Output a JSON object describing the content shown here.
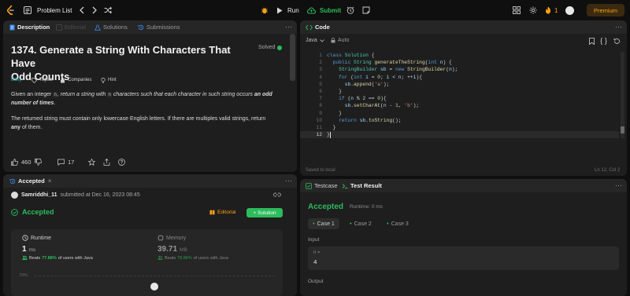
{
  "topbar": {
    "problem_list": "Problem List",
    "run_label": "Run",
    "submit_label": "Submit",
    "streak_count": "1",
    "premium_label": "Premium"
  },
  "description_panel": {
    "tabs": [
      "Description",
      "Editorial",
      "Solutions",
      "Submissions"
    ],
    "title_line1": "1374. Generate a String With Characters That Have",
    "title_line2": "Odd Counts",
    "solved_label": "Solved",
    "difficulty": "Easy",
    "topics_label": "Topics",
    "companies_label": "Companies",
    "hint_label": "Hint",
    "para1_a": "Given an integer ",
    "para1_code1": "n",
    "para1_b": ", return a string with ",
    "para1_code2": "n",
    "para1_c": " characters such that each character in such string occurs ",
    "para1_bold": "an odd",
    "para1_bold2": "number of times",
    "para1_end": ".",
    "para2_a": "The returned string must contain only lowercase English letters. If there are multiples valid strings, return",
    "para2_bold": "any",
    "para2_b": " of them.",
    "likes": "460",
    "comments": "17"
  },
  "accepted_panel": {
    "tab_label": "Accepted",
    "username": "Samriddhi_11",
    "submitted_text": "submitted at Dec 16, 2023 08:45",
    "status": "Accepted",
    "editorial_label": "Editorial",
    "solution_label": "Solution",
    "runtime_label": "Runtime",
    "runtime_value": "1",
    "runtime_unit": "ms",
    "runtime_beats_prefix": "Beats ",
    "runtime_beats": "77.88%",
    "runtime_beats_suffix": " of users with Java",
    "memory_label": "Memory",
    "memory_value": "39.71",
    "memory_unit": "MB",
    "memory_beats_prefix": "Beats ",
    "memory_beats": "76.96%",
    "memory_beats_suffix": " of users with Java",
    "chart_tick": "70%"
  },
  "code_panel": {
    "tab_label": "Code",
    "language": "Java",
    "auto_label": "Auto",
    "lines": [
      "class Solution {",
      "    public String generateTheString(int n) {",
      "        StringBuilder sb = new StringBuilder(n);",
      "        for (int i = 0; i < n; ++i){",
      "            sb.append('a');",
      "        }",
      "        if (n % 2 == 0){",
      "            sb.setCharAt(n - 1, 'b');",
      "        }",
      "        return sb.toString();",
      "    }",
      "}"
    ],
    "saved_label": "Saved to local",
    "cursor_pos": "Ln 12, Col 2"
  },
  "test_panel": {
    "testcase_label": "Testcase",
    "result_label": "Test Result",
    "status": "Accepted",
    "runtime_text": "Runtime: 0 ms",
    "cases": [
      "Case 1",
      "Case 2",
      "Case 3"
    ],
    "input_label": "Input",
    "var_name": "n =",
    "var_value": "4",
    "output_label": "Output"
  },
  "colors": {
    "accent_green": "#2cbb5d",
    "accent_orange": "#ffa116",
    "background": "#0f0f0f",
    "panel": "#1e1e1e"
  }
}
